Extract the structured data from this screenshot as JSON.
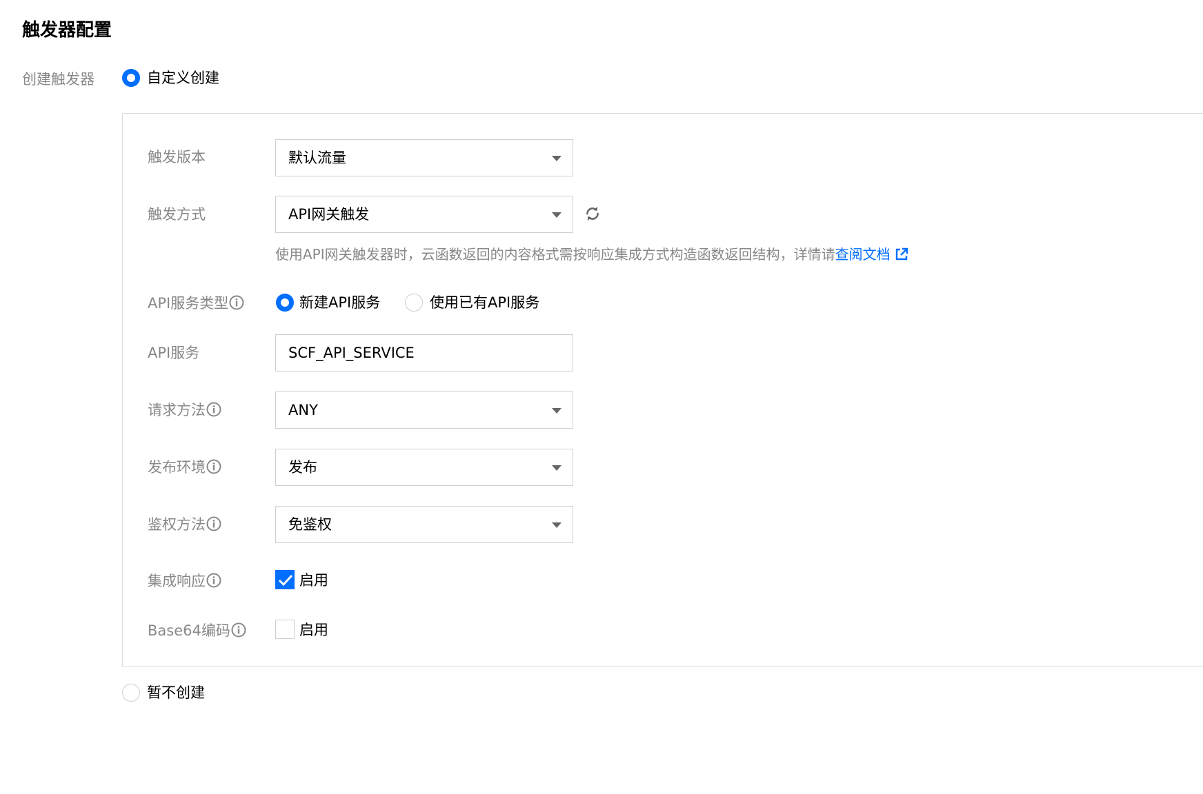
{
  "section": {
    "title": "触发器配置"
  },
  "create_trigger": {
    "label": "创建触发器",
    "option_custom": "自定义创建",
    "option_none": "暂不创建",
    "selected": "自定义创建"
  },
  "form": {
    "version": {
      "label": "触发版本",
      "value": "默认流量"
    },
    "method": {
      "label": "触发方式",
      "value": "API网关触发",
      "hint_text": "使用API网关触发器时，云函数返回的内容格式需按响应集成方式构造函数返回结构，详情请",
      "hint_link": "查阅文档"
    },
    "api_service_type": {
      "label": "API服务类型",
      "option_new": "新建API服务",
      "option_existing": "使用已有API服务",
      "selected": "新建API服务"
    },
    "api_service": {
      "label": "API服务",
      "value": "SCF_API_SERVICE"
    },
    "request_method": {
      "label": "请求方法",
      "value": "ANY"
    },
    "env": {
      "label": "发布环境",
      "value": "发布"
    },
    "auth": {
      "label": "鉴权方法",
      "value": "免鉴权"
    },
    "integrated_response": {
      "label": "集成响应",
      "checkbox_label": "启用",
      "checked": true
    },
    "base64": {
      "label": "Base64编码",
      "checkbox_label": "启用",
      "checked": false
    }
  },
  "colors": {
    "accent": "#006eff",
    "label": "#888888",
    "border": "#cfcfcf",
    "panel_border": "#dcdcdc"
  },
  "icons": [
    "info-icon",
    "refresh-icon",
    "external-link-icon",
    "chevron-down-icon",
    "checkmark-icon"
  ]
}
